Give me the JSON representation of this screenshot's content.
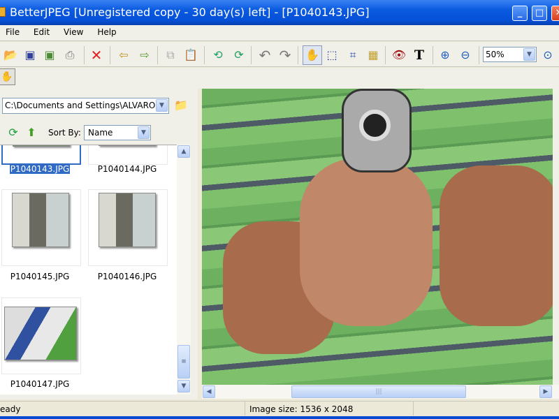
{
  "window": {
    "title": "BetterJPEG [Unregistered copy - 30 day(s) left] - [P1040143.JPG]",
    "minimize": "_",
    "maximize": "□",
    "close": "✕"
  },
  "menu": [
    "File",
    "Edit",
    "View",
    "Help"
  ],
  "toolbar": {
    "icons": [
      "open-icon",
      "save-icon",
      "save-as-icon",
      "print-icon",
      "delete-icon",
      "prev-image-icon",
      "next-image-icon",
      "copy-icon",
      "paste-icon",
      "rotate-left-icon",
      "rotate-right-icon",
      "undo-icon",
      "redo-icon",
      "hand-tool-icon",
      "select-icon",
      "crop-icon",
      "adjust-icon",
      "red-eye-icon",
      "text-icon",
      "zoom-in-icon",
      "zoom-out-icon"
    ],
    "zoom_value": "50%"
  },
  "browser": {
    "path": "C:\\Documents and Settings\\ALVARO",
    "sort_label": "Sort By:",
    "sort_value": "Name",
    "files": [
      {
        "name": "P1040143.JPG",
        "selected": true
      },
      {
        "name": "P1040144.JPG"
      },
      {
        "name": "P1040145.JPG"
      },
      {
        "name": "P1040146.JPG"
      },
      {
        "name": "P1040147.JPG"
      }
    ]
  },
  "status": {
    "left": "eady",
    "image_size": "Image size:  1536 x 2048"
  }
}
